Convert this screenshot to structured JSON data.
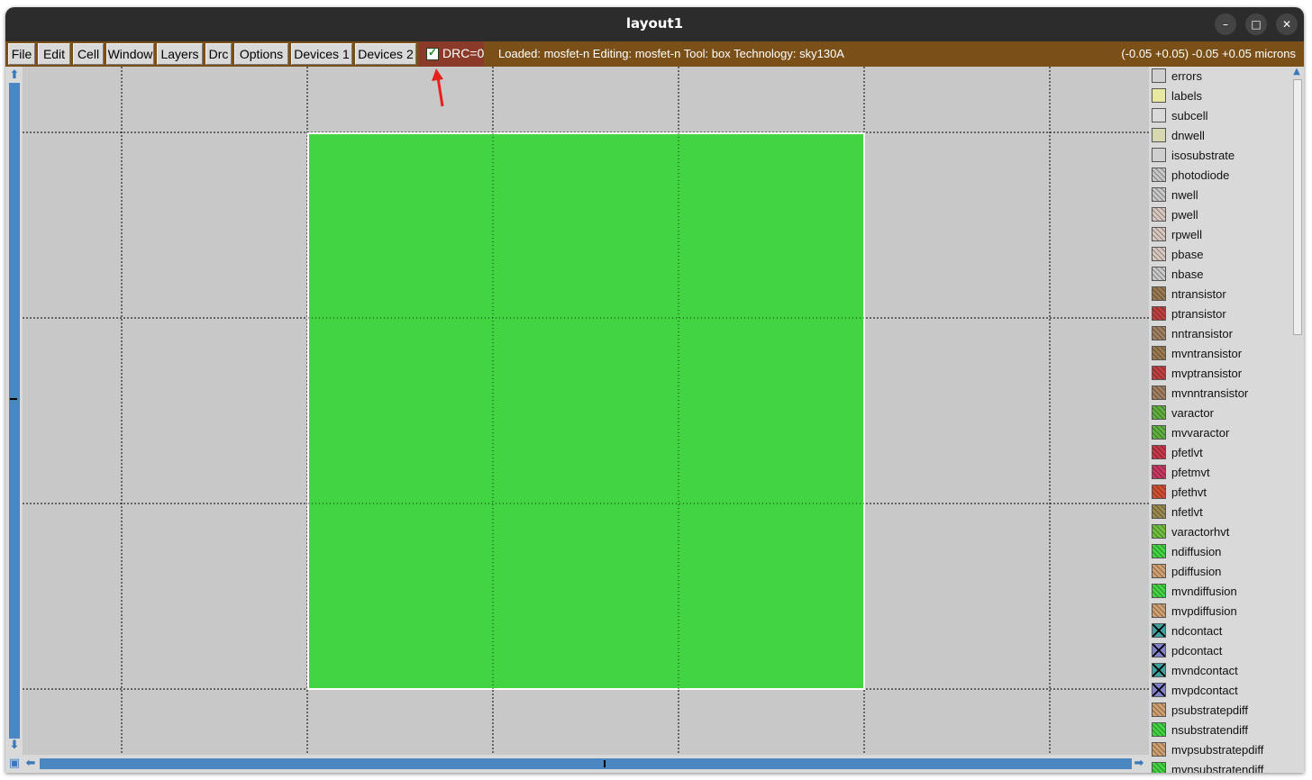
{
  "window": {
    "title": "layout1",
    "minimize_icon": "minimize-icon",
    "maximize_icon": "maximize-icon",
    "close_icon": "close-icon"
  },
  "menu": {
    "items": [
      "File",
      "Edit",
      "Cell",
      "Window",
      "Layers",
      "Drc",
      "Options",
      "Devices 1",
      "Devices 2"
    ]
  },
  "drc": {
    "label": "DRC=0",
    "checked": true
  },
  "status": {
    "text": "Loaded: mosfet-n Editing: mosfet-n Tool: box  Technology: sky130A",
    "coords": "(-0.05 +0.05) -0.05 +0.05 microns"
  },
  "annotation": {
    "arrow_color": "#e8201c"
  },
  "canvas": {
    "background": "#c8c8c8",
    "box_fill": "#42d442",
    "box_border": "#ffffff"
  },
  "layers": [
    {
      "name": "errors",
      "color": "#d0d0d0"
    },
    {
      "name": "labels",
      "color": "#e8e8a0"
    },
    {
      "name": "subcell",
      "color": "#d9d9d9"
    },
    {
      "name": "dnwell",
      "color": "#d8d8b0"
    },
    {
      "name": "isosubstrate",
      "color": "#cfcfcf"
    },
    {
      "name": "photodiode",
      "color": "#c8c8c8"
    },
    {
      "name": "nwell",
      "color": "#c8c8c8"
    },
    {
      "name": "pwell",
      "color": "#d8c8c0"
    },
    {
      "name": "rpwell",
      "color": "#d8c8c0"
    },
    {
      "name": "pbase",
      "color": "#d8c8c0"
    },
    {
      "name": "nbase",
      "color": "#c8c8c8"
    },
    {
      "name": "ntransistor",
      "color": "#9a7a50"
    },
    {
      "name": "ptransistor",
      "color": "#c04040"
    },
    {
      "name": "nntransistor",
      "color": "#a08060"
    },
    {
      "name": "mvntransistor",
      "color": "#9a7a50"
    },
    {
      "name": "mvptransistor",
      "color": "#c04040"
    },
    {
      "name": "mvnntransistor",
      "color": "#a08060"
    },
    {
      "name": "varactor",
      "color": "#60b040"
    },
    {
      "name": "mvvaractor",
      "color": "#60b040"
    },
    {
      "name": "pfetlvt",
      "color": "#c83848"
    },
    {
      "name": "pfetmvt",
      "color": "#c83860"
    },
    {
      "name": "pfethvt",
      "color": "#d05030"
    },
    {
      "name": "nfetlvt",
      "color": "#9a8a50"
    },
    {
      "name": "varactorhvt",
      "color": "#70c040"
    },
    {
      "name": "ndiffusion",
      "color": "#42d442"
    },
    {
      "name": "pdiffusion",
      "color": "#d0a070"
    },
    {
      "name": "mvndiffusion",
      "color": "#42d442"
    },
    {
      "name": "mvpdiffusion",
      "color": "#d0a070"
    },
    {
      "name": "ndcontact",
      "color": "#40a0a0"
    },
    {
      "name": "pdcontact",
      "color": "#8080c8"
    },
    {
      "name": "mvndcontact",
      "color": "#40a0a0"
    },
    {
      "name": "mvpdcontact",
      "color": "#8080c8"
    },
    {
      "name": "psubstratepdiff",
      "color": "#d0a070"
    },
    {
      "name": "nsubstratendiff",
      "color": "#42d442"
    },
    {
      "name": "mvpsubstratepdiff",
      "color": "#d0a070"
    },
    {
      "name": "mvnsubstratendiff",
      "color": "#42d442"
    }
  ]
}
